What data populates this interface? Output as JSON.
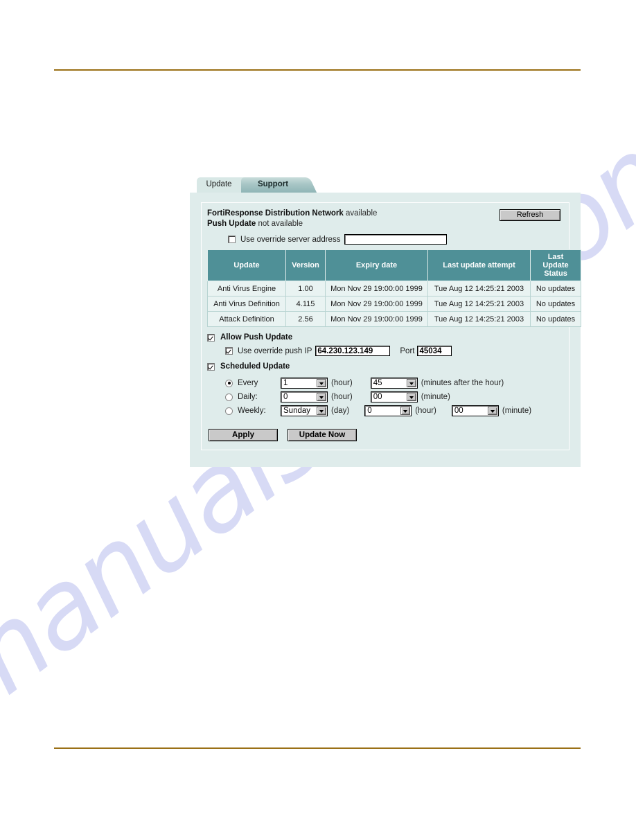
{
  "watermark": {
    "text": "manualshive.com"
  },
  "tabs": [
    {
      "label": "Update",
      "active": true
    },
    {
      "label": "Support",
      "active": false
    }
  ],
  "status": {
    "frdn_label": "FortiResponse Distribution Network",
    "frdn_value": "available",
    "push_label": "Push Update",
    "push_value": "not available",
    "refresh_label": "Refresh"
  },
  "override_server": {
    "checkbox_label": "Use override server address",
    "checked": false,
    "value": "",
    "placeholder": ""
  },
  "table": {
    "columns": [
      "Update",
      "Version",
      "Expiry date",
      "Last update attempt",
      "Last Update Status"
    ],
    "column_last_status_lines": [
      "Last",
      "Update",
      "Status"
    ],
    "rows": [
      {
        "update": "Anti Virus Engine",
        "version": "1.00",
        "expiry": "Mon Nov 29 19:00:00 1999",
        "last_attempt": "Tue Aug 12 14:25:21 2003",
        "status": "No updates"
      },
      {
        "update": "Anti Virus Definition",
        "version": "4.115",
        "expiry": "Mon Nov 29 19:00:00 1999",
        "last_attempt": "Tue Aug 12 14:25:21 2003",
        "status": "No updates"
      },
      {
        "update": "Attack Definition",
        "version": "2.56",
        "expiry": "Mon Nov 29 19:00:00 1999",
        "last_attempt": "Tue Aug 12 14:25:21 2003",
        "status": "No updates"
      }
    ]
  },
  "push_update": {
    "section_label": "Allow Push Update",
    "section_checked": true,
    "override_ip_label": "Use override push IP",
    "override_ip_checked": true,
    "ip_value": "64.230.123.149",
    "port_label": "Port",
    "port_value": "45034"
  },
  "scheduled_update": {
    "section_label": "Scheduled Update",
    "section_checked": true,
    "rows": [
      {
        "name": "every",
        "label": "Every",
        "selected": true,
        "fields": [
          {
            "value": "1",
            "unit": "(hour)"
          },
          {
            "value": "45",
            "unit": "(minutes after the hour)"
          }
        ]
      },
      {
        "name": "daily",
        "label": "Daily:",
        "selected": false,
        "fields": [
          {
            "value": "0",
            "unit": "(hour)"
          },
          {
            "value": "00",
            "unit": "(minute)"
          }
        ]
      },
      {
        "name": "weekly",
        "label": "Weekly:",
        "selected": false,
        "fields": [
          {
            "value": "Sunday",
            "unit": "(day)"
          },
          {
            "value": "0",
            "unit": "(hour)"
          },
          {
            "value": "00",
            "unit": "(minute)"
          }
        ]
      }
    ]
  },
  "actions": {
    "apply_label": "Apply",
    "update_now_label": "Update Now"
  },
  "colors": {
    "rule": "#9a7016",
    "panel_bg": "#dfeceb",
    "table_header": "#4f9097",
    "table_cell": "#e9f3f2",
    "watermark": "#c9cdf2"
  }
}
